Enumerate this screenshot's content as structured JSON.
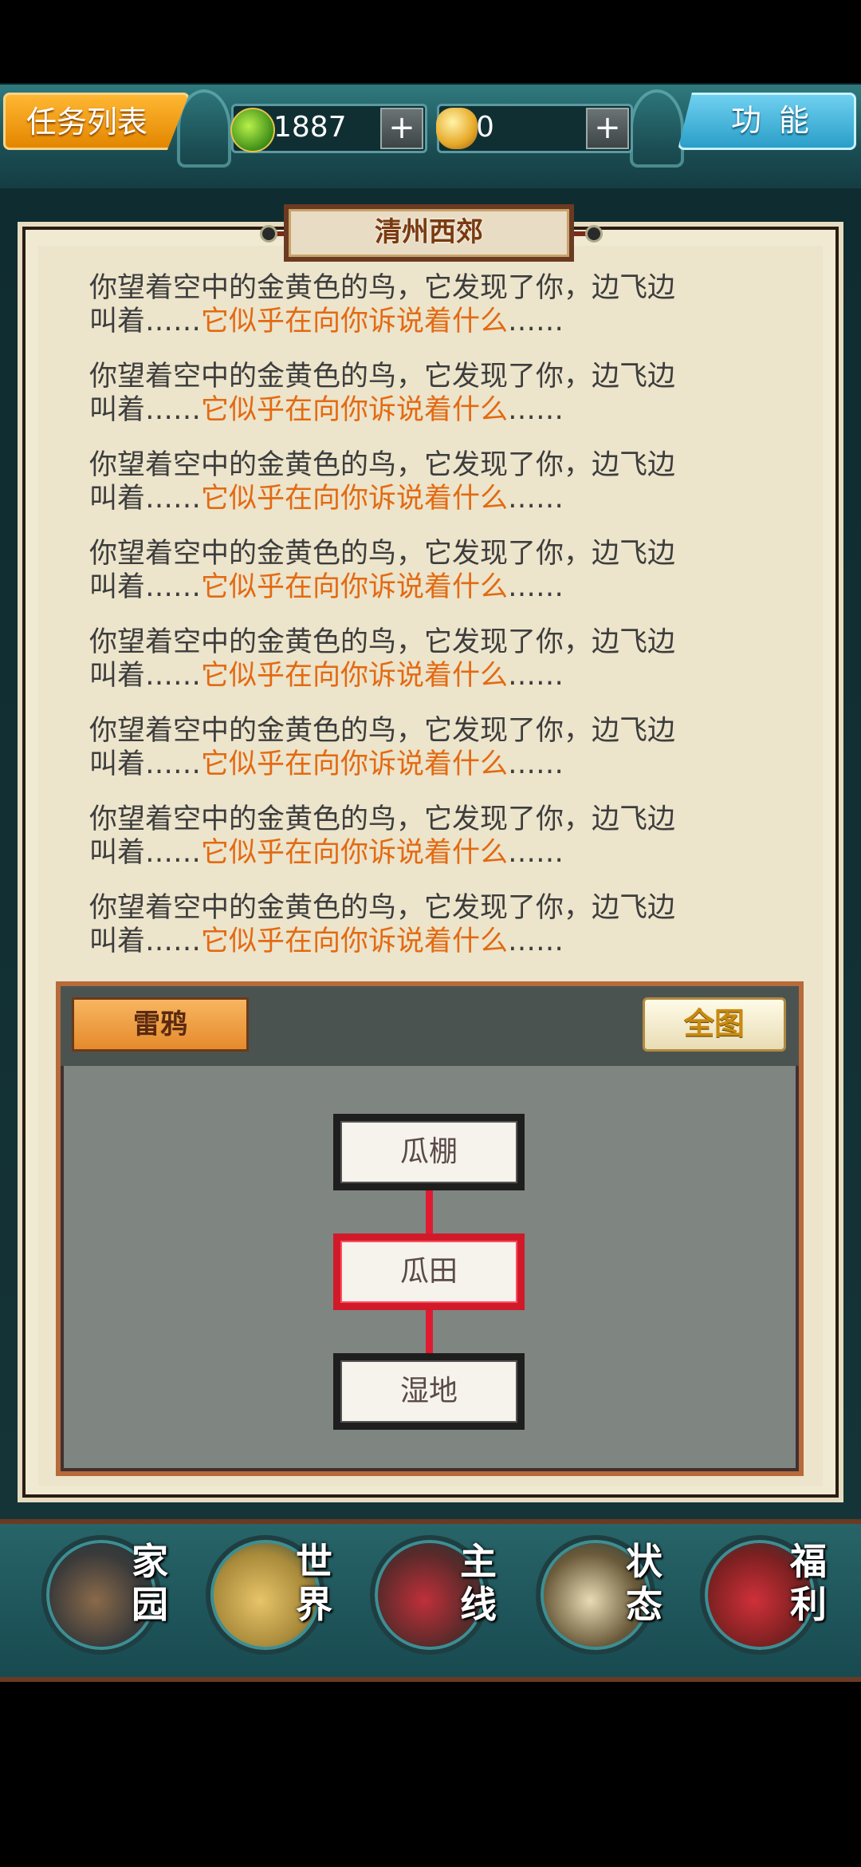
{
  "header": {
    "task_list_label": "任务列表",
    "jade_value": "1887",
    "gold_value": "0",
    "plus_label": "+",
    "function_label": "功能"
  },
  "location_title": "清州西郊",
  "messages": [
    {
      "line1": "你望着空中的金黄色的鸟，它发现了你，边飞边",
      "prefix": "叫着……",
      "highlight": "它似乎在向你诉说着什么",
      "suffix": "……"
    },
    {
      "line1": "你望着空中的金黄色的鸟，它发现了你，边飞边",
      "prefix": "叫着……",
      "highlight": "它似乎在向你诉说着什么",
      "suffix": "……"
    },
    {
      "line1": "你望着空中的金黄色的鸟，它发现了你，边飞边",
      "prefix": "叫着……",
      "highlight": "它似乎在向你诉说着什么",
      "suffix": "……"
    },
    {
      "line1": "你望着空中的金黄色的鸟，它发现了你，边飞边",
      "prefix": "叫着……",
      "highlight": "它似乎在向你诉说着什么",
      "suffix": "……"
    },
    {
      "line1": "你望着空中的金黄色的鸟，它发现了你，边飞边",
      "prefix": "叫着……",
      "highlight": "它似乎在向你诉说着什么",
      "suffix": "……"
    },
    {
      "line1": "你望着空中的金黄色的鸟，它发现了你，边飞边",
      "prefix": "叫着……",
      "highlight": "它似乎在向你诉说着什么",
      "suffix": "……"
    },
    {
      "line1": "你望着空中的金黄色的鸟，它发现了你，边飞边",
      "prefix": "叫着……",
      "highlight": "它似乎在向你诉说着什么",
      "suffix": "……"
    },
    {
      "line1": "你望着空中的金黄色的鸟，它发现了你，边飞边",
      "prefix": "叫着……",
      "highlight": "它似乎在向你诉说着什么",
      "suffix": "……"
    }
  ],
  "map": {
    "region_label": "雷鸦",
    "full_map_label": "全图",
    "nodes": [
      {
        "label": "瓜棚",
        "active": false
      },
      {
        "label": "瓜田",
        "active": true
      },
      {
        "label": "湿地",
        "active": false
      }
    ]
  },
  "bottom_nav": [
    {
      "label": "家园",
      "icon": "home-garden-icon"
    },
    {
      "label": "世界",
      "icon": "world-map-icon"
    },
    {
      "label": "主线",
      "icon": "main-quest-icon"
    },
    {
      "label": "状态",
      "icon": "status-bagua-icon"
    },
    {
      "label": "福利",
      "icon": "welfare-bag-icon"
    }
  ],
  "colors": {
    "highlight_text": "#e36a12",
    "active_node_border": "#d01a2a",
    "task_button": "#f0a020",
    "function_button": "#3aaed8"
  }
}
